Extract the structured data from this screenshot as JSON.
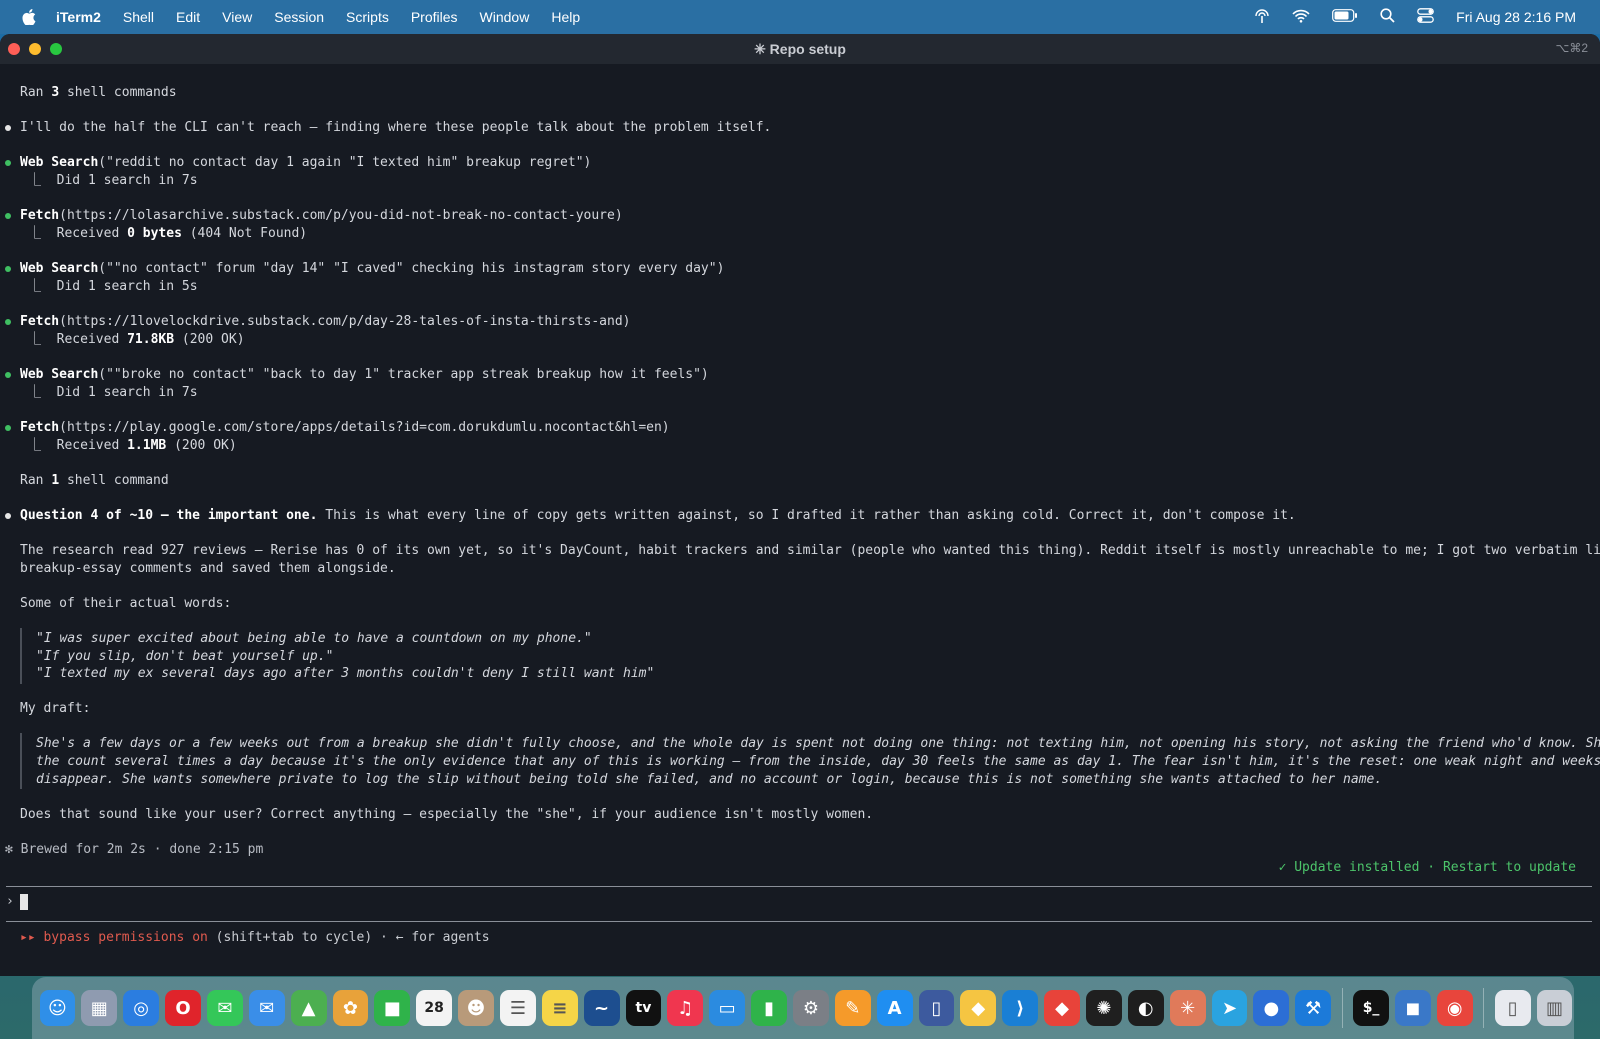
{
  "menubar": {
    "app": "iTerm2",
    "items": [
      "Shell",
      "Edit",
      "View",
      "Session",
      "Scripts",
      "Profiles",
      "Window",
      "Help"
    ],
    "clock": "Fri Aug 28  2:16 PM"
  },
  "window": {
    "title": "✳ Repo setup",
    "shortcut": "⌥⌘2"
  },
  "terminal": {
    "ran3_prefix": "Ran ",
    "ran3_count": "3",
    "ran3_suffix": " shell commands",
    "intro": "I'll do the half the CLI can't reach — finding where these people talk about the problem itself.",
    "tools": [
      {
        "name": "Web Search",
        "arg": "(\"reddit no contact day 1 again \"I texted him\" breakup regret\")",
        "result_pre": "Did 1 search in 7s",
        "result_bold": "",
        "result_post": ""
      },
      {
        "name": "Fetch",
        "arg": "(https://lolasarchive.substack.com/p/you-did-not-break-no-contact-youre)",
        "result_pre": "Received ",
        "result_bold": "0 bytes",
        "result_post": " (404 Not Found)"
      },
      {
        "name": "Web Search",
        "arg": "(\"\"no contact\" forum \"day 14\" \"I caved\" checking his instagram story every day\")",
        "result_pre": "Did 1 search in 5s",
        "result_bold": "",
        "result_post": ""
      },
      {
        "name": "Fetch",
        "arg": "(https://1lovelockdrive.substack.com/p/day-28-tales-of-insta-thirsts-and)",
        "result_pre": "Received ",
        "result_bold": "71.8KB",
        "result_post": " (200 OK)"
      },
      {
        "name": "Web Search",
        "arg": "(\"\"broke no contact\" \"back to day 1\" tracker app streak breakup how it feels\")",
        "result_pre": "Did 1 search in 7s",
        "result_bold": "",
        "result_post": ""
      },
      {
        "name": "Fetch",
        "arg": "(https://play.google.com/store/apps/details?id=com.dorukdumlu.nocontact&hl=en)",
        "result_pre": "Received ",
        "result_bold": "1.1MB",
        "result_post": " (200 OK)"
      }
    ],
    "ran1_prefix": "Ran ",
    "ran1_count": "1",
    "ran1_suffix": " shell command",
    "question_bold": "Question 4 of ~10 — the important one.",
    "question_rest": " This is what every line of copy gets written against, so I drafted it rather than asking cold. Correct it, don't compose it.",
    "research_1": "The research read 927 reviews — Rerise has 0 of its own yet, so it's DayCount, habit trackers and similar (people who wanted this thing). Reddit itself is mostly unreachable to me; I got two verbatim lines from",
    "research_2": "breakup-essay comments and saved them alongside.",
    "words_label": "Some of their actual words:",
    "quotes": [
      "\"I was super excited about being able to have a countdown on my phone.\"",
      "\"If you slip, don't beat yourself up.\"",
      "\"I texted my ex several days ago after 3 months couldn't deny I still want him\""
    ],
    "draft_label": "My draft:",
    "draft_lines": [
      "She's a few days or a few weeks out from a breakup she didn't fully choose, and the whole day is spent not doing one thing: not texting him, not opening his story, not asking the friend who'd know. She checks",
      "the count several times a day because it's the only evidence that any of this is working — from the inside, day 30 feels the same as day 1. The fear isn't him, it's the reset: one weak night and weeks of proof",
      "disappear. She wants somewhere private to log the slip without being told she failed, and no account or login, because this is not something she wants attached to her name."
    ],
    "closing": "Does that sound like your user? Correct anything — especially the \"she\", if your audience isn't mostly women.",
    "brewed": "✻ Brewed for 2m 2s · done 2:15 pm",
    "update": "✓ Update installed · Restart to update",
    "prompt_symbol": "›",
    "bypass_icon": "▸▸",
    "bypass_red": " bypass permissions on",
    "bypass_rest": " (shift+tab to cycle) · ← for agents"
  },
  "dock": {
    "items": [
      {
        "name": "finder",
        "glyph": "☺",
        "color": "#2f8fe8"
      },
      {
        "name": "launchpad",
        "glyph": "▦",
        "color": "#8f9bb0"
      },
      {
        "name": "safari",
        "glyph": "◎",
        "color": "#2b7de0"
      },
      {
        "name": "opera",
        "glyph": "O",
        "color": "#e0242b"
      },
      {
        "name": "messages",
        "glyph": "✉",
        "color": "#34c759"
      },
      {
        "name": "mail",
        "glyph": "✉",
        "color": "#3a8ee8"
      },
      {
        "name": "maps",
        "glyph": "▲",
        "color": "#4caf50"
      },
      {
        "name": "photos",
        "glyph": "✿",
        "color": "#e8a23a"
      },
      {
        "name": "facetime",
        "glyph": "■",
        "color": "#2fb34a"
      },
      {
        "name": "calendar",
        "glyph": "28",
        "color": "#f3f3f3"
      },
      {
        "name": "contacts",
        "glyph": "☻",
        "color": "#b89a7a"
      },
      {
        "name": "reminders",
        "glyph": "☰",
        "color": "#f3f3f3"
      },
      {
        "name": "notes",
        "glyph": "≡",
        "color": "#f5d547"
      },
      {
        "name": "freeform",
        "glyph": "~",
        "color": "#1d4e8f"
      },
      {
        "name": "tv",
        "glyph": "tv",
        "color": "#111111"
      },
      {
        "name": "music",
        "glyph": "♫",
        "color": "#f0364f"
      },
      {
        "name": "keynote",
        "glyph": "▭",
        "color": "#2b8be0"
      },
      {
        "name": "numbers",
        "glyph": "▮",
        "color": "#2fb34a"
      },
      {
        "name": "system-settings",
        "glyph": "⚙",
        "color": "#7b7f86"
      },
      {
        "name": "pages",
        "glyph": "✎",
        "color": "#f59a2a"
      },
      {
        "name": "app-store",
        "glyph": "A",
        "color": "#1f8ef1"
      },
      {
        "name": "simulator",
        "glyph": "▯",
        "color": "#3d5a9e"
      },
      {
        "name": "cyberduck",
        "glyph": "◆",
        "color": "#f5c542"
      },
      {
        "name": "vscode",
        "glyph": "⟩",
        "color": "#1a7fd4"
      },
      {
        "name": "anydesk",
        "glyph": "◆",
        "color": "#e8433a"
      },
      {
        "name": "chatgpt",
        "glyph": "✺",
        "color": "#1f1f1f"
      },
      {
        "name": "figma",
        "glyph": "◐",
        "color": "#1e1e1e"
      },
      {
        "name": "claude",
        "glyph": "✳",
        "color": "#e07a5a"
      },
      {
        "name": "telegram",
        "glyph": "➤",
        "color": "#2aa3e0"
      },
      {
        "name": "proton-vpn",
        "glyph": "●",
        "color": "#2c6ed5"
      },
      {
        "name": "xcode",
        "glyph": "⚒",
        "color": "#1c7ad9"
      },
      {
        "name": "iterm",
        "glyph": "$_",
        "color": "#111111"
      },
      {
        "name": "migration",
        "glyph": "◼",
        "color": "#3a78c8"
      },
      {
        "name": "chrome",
        "glyph": "◉",
        "color": "#e8453c"
      },
      {
        "name": "document",
        "glyph": "▯",
        "color": "#e8eaef"
      },
      {
        "name": "trash",
        "glyph": "▥",
        "color": "#c9ced6"
      }
    ]
  }
}
